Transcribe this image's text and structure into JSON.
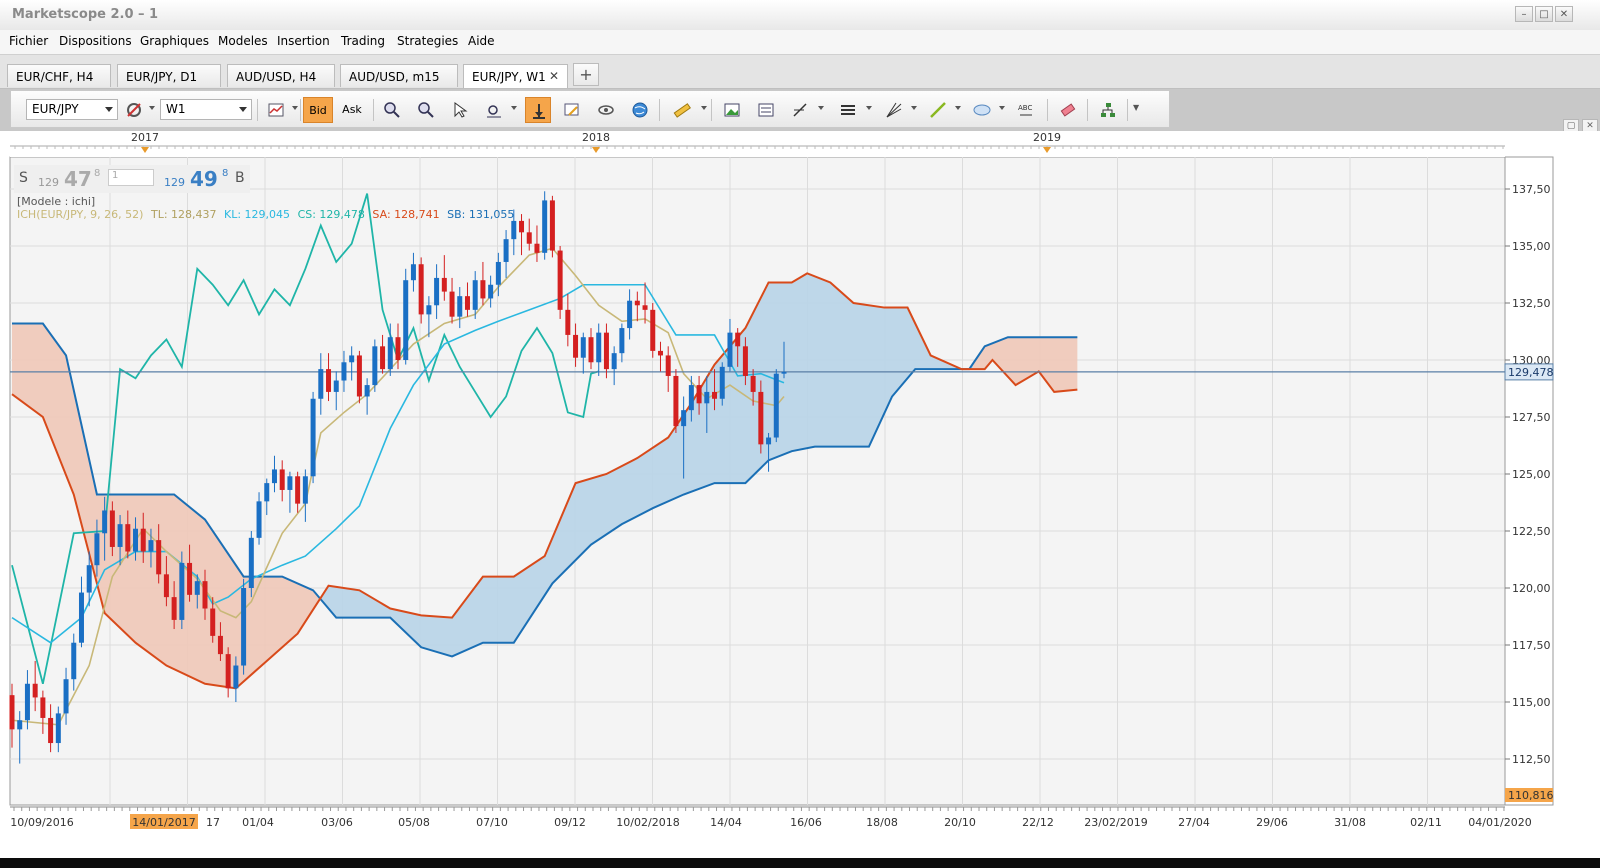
{
  "window": {
    "title": "Marketscope 2.0 – 1",
    "buttons": [
      "–",
      "□",
      "✕"
    ]
  },
  "menu": [
    "Fichier",
    "Dispositions",
    "Graphiques",
    "Modeles",
    "Insertion",
    "Trading",
    "Strategies",
    "Aide"
  ],
  "tabs": [
    {
      "label": "EUR/CHF, H4",
      "active": false
    },
    {
      "label": "EUR/JPY, D1",
      "active": false
    },
    {
      "label": "AUD/USD, H4",
      "active": false
    },
    {
      "label": "AUD/USD, m15",
      "active": false
    },
    {
      "label": "EUR/JPY, W1",
      "active": true,
      "close": "✕"
    }
  ],
  "tab_add": "+",
  "toolbar": {
    "symbol": "EUR/JPY",
    "timeframe": "W1",
    "bid_label": "Bid",
    "ask_label": "Ask",
    "accent": "#f5a54a"
  },
  "quote": {
    "sell_label": "S",
    "sell_big": "129",
    "sell_pips": "47",
    "sell_frac": "8",
    "amount": "1",
    "buy_big": "129",
    "buy_pips": "49",
    "buy_frac": "8",
    "buy_label": "B"
  },
  "legend": {
    "model": "[Modele : ichi]",
    "ich": "ICH(EUR/JPY, 9, 26, 52)",
    "tl": "TL: 128,437",
    "kl": "KL: 129,045",
    "cs": "CS: 129,478",
    "sa": "SA: 128,741",
    "sb": "SB: 131,055"
  },
  "chart_data": {
    "type": "candlestick",
    "symbol": "EUR/JPY",
    "timeframe": "W1",
    "title": "",
    "ylim": [
      110.816,
      138.5
    ],
    "y_ticks": [
      "137,50",
      "135,00",
      "132,50",
      "130,00",
      "127,50",
      "125,00",
      "122,50",
      "120,00",
      "117,50",
      "115,00",
      "112,50"
    ],
    "year_labels": [
      "2017",
      "2018",
      "2019"
    ],
    "x_ticks": [
      "10/09/2016",
      "14/01/2017",
      "17",
      "01/04",
      "03/06",
      "05/08",
      "07/10",
      "09/12",
      "10/02/2018",
      "14/04",
      "16/06",
      "18/08",
      "20/10",
      "22/12",
      "23/02/2019",
      "27/04",
      "29/06",
      "31/08",
      "02/11",
      "04/01/2020"
    ],
    "current_price": "129,478",
    "min_label": "110,816",
    "grid": true,
    "colors": {
      "up": "#1a6fc4",
      "down": "#d42020",
      "tenkan": "#c8b878",
      "kijun": "#2ab8e0",
      "chikou": "#1fb5a8",
      "span_a": "#d84a1a",
      "span_b": "#1a6fb5",
      "cloud_bull": "#b8d4e8",
      "cloud_bear": "#f0c8b8",
      "price_line": "#5a7fa6"
    },
    "candles": [
      [
        115.3,
        115.8,
        113.0,
        113.8
      ],
      [
        113.8,
        114.6,
        112.3,
        114.2
      ],
      [
        114.2,
        116.4,
        113.8,
        115.8
      ],
      [
        115.8,
        116.8,
        114.6,
        115.2
      ],
      [
        115.2,
        115.5,
        113.6,
        114.3
      ],
      [
        114.3,
        114.9,
        112.8,
        113.2
      ],
      [
        113.2,
        114.8,
        112.8,
        114.5
      ],
      [
        114.5,
        116.5,
        114.0,
        116.0
      ],
      [
        116.0,
        118.0,
        115.5,
        117.6
      ],
      [
        117.6,
        120.5,
        117.4,
        119.8
      ],
      [
        119.8,
        121.6,
        119.2,
        121.0
      ],
      [
        121.0,
        123.0,
        120.5,
        122.4
      ],
      [
        122.4,
        124.0,
        121.2,
        123.4
      ],
      [
        123.4,
        123.8,
        121.4,
        121.8
      ],
      [
        121.8,
        123.2,
        121.0,
        122.8
      ],
      [
        122.8,
        123.4,
        121.3,
        121.6
      ],
      [
        121.6,
        123.1,
        121.2,
        122.6
      ],
      [
        122.6,
        123.3,
        121.1,
        121.6
      ],
      [
        121.6,
        122.6,
        120.9,
        122.1
      ],
      [
        122.1,
        122.8,
        120.2,
        120.6
      ],
      [
        120.6,
        121.4,
        119.2,
        119.6
      ],
      [
        119.6,
        120.3,
        118.2,
        118.6
      ],
      [
        118.6,
        121.6,
        118.2,
        121.1
      ],
      [
        121.1,
        121.9,
        119.4,
        119.7
      ],
      [
        119.7,
        120.6,
        119.1,
        120.3
      ],
      [
        120.3,
        120.8,
        118.6,
        119.1
      ],
      [
        119.1,
        119.6,
        117.6,
        117.9
      ],
      [
        117.9,
        118.5,
        116.8,
        117.1
      ],
      [
        117.1,
        117.4,
        115.2,
        115.6
      ],
      [
        115.6,
        117.0,
        115.0,
        116.6
      ],
      [
        116.6,
        120.4,
        116.2,
        120.0
      ],
      [
        120.0,
        122.5,
        119.6,
        122.2
      ],
      [
        122.2,
        124.2,
        121.9,
        123.8
      ],
      [
        123.8,
        124.8,
        123.2,
        124.6
      ],
      [
        124.6,
        125.8,
        124.2,
        125.2
      ],
      [
        125.2,
        125.6,
        123.8,
        124.3
      ],
      [
        124.3,
        125.1,
        123.3,
        124.9
      ],
      [
        124.9,
        125.1,
        123.3,
        123.7
      ],
      [
        123.7,
        125.2,
        122.9,
        124.9
      ],
      [
        124.9,
        128.6,
        124.6,
        128.3
      ],
      [
        128.3,
        130.3,
        127.6,
        129.6
      ],
      [
        129.6,
        130.3,
        128.2,
        128.6
      ],
      [
        128.6,
        129.5,
        127.8,
        129.1
      ],
      [
        129.1,
        130.4,
        128.6,
        129.9
      ],
      [
        129.9,
        130.6,
        129.1,
        130.2
      ],
      [
        130.2,
        130.4,
        128.1,
        128.4
      ],
      [
        128.4,
        129.2,
        127.6,
        128.9
      ],
      [
        128.9,
        130.9,
        128.6,
        130.6
      ],
      [
        130.6,
        131.1,
        129.4,
        129.6
      ],
      [
        129.6,
        131.6,
        129.3,
        131.0
      ],
      [
        131.0,
        131.6,
        129.6,
        130.0
      ],
      [
        130.0,
        134.0,
        129.8,
        133.5
      ],
      [
        133.5,
        134.7,
        133.0,
        134.2
      ],
      [
        134.2,
        134.5,
        131.6,
        132.0
      ],
      [
        132.0,
        132.8,
        131.0,
        132.4
      ],
      [
        132.4,
        134.2,
        131.8,
        133.6
      ],
      [
        133.6,
        134.6,
        132.6,
        133.0
      ],
      [
        133.0,
        133.6,
        131.6,
        131.9
      ],
      [
        131.9,
        133.2,
        131.4,
        132.8
      ],
      [
        132.8,
        133.4,
        131.9,
        132.2
      ],
      [
        132.2,
        133.9,
        131.8,
        133.5
      ],
      [
        133.5,
        134.3,
        132.4,
        132.7
      ],
      [
        132.7,
        133.7,
        132.3,
        133.3
      ],
      [
        133.3,
        134.7,
        132.8,
        134.3
      ],
      [
        134.3,
        135.7,
        133.6,
        135.3
      ],
      [
        135.3,
        136.6,
        134.6,
        136.1
      ],
      [
        136.1,
        136.4,
        134.6,
        135.6
      ],
      [
        135.6,
        136.2,
        134.8,
        135.1
      ],
      [
        135.1,
        135.9,
        134.3,
        134.7
      ],
      [
        134.7,
        137.4,
        134.4,
        137.0
      ],
      [
        137.0,
        137.2,
        134.5,
        134.8
      ],
      [
        134.8,
        135.0,
        131.8,
        132.2
      ],
      [
        132.2,
        132.9,
        130.6,
        131.1
      ],
      [
        131.1,
        131.6,
        129.7,
        130.1
      ],
      [
        130.1,
        131.2,
        129.4,
        131.0
      ],
      [
        131.0,
        131.4,
        129.6,
        129.9
      ],
      [
        129.9,
        131.6,
        129.3,
        131.2
      ],
      [
        131.2,
        131.6,
        129.2,
        129.6
      ],
      [
        129.6,
        130.6,
        128.9,
        130.3
      ],
      [
        130.3,
        131.6,
        129.9,
        131.4
      ],
      [
        131.4,
        133.1,
        130.9,
        132.6
      ],
      [
        132.6,
        133.0,
        131.7,
        132.4
      ],
      [
        132.4,
        133.4,
        131.6,
        132.2
      ],
      [
        132.2,
        132.5,
        130.1,
        130.4
      ],
      [
        130.4,
        130.8,
        129.5,
        130.2
      ],
      [
        130.2,
        130.6,
        128.6,
        129.3
      ],
      [
        129.3,
        129.6,
        126.8,
        127.1
      ],
      [
        127.1,
        128.4,
        124.8,
        127.8
      ],
      [
        127.8,
        129.3,
        127.3,
        128.9
      ],
      [
        128.9,
        129.3,
        127.6,
        128.1
      ],
      [
        128.1,
        129.3,
        126.8,
        128.6
      ],
      [
        128.6,
        129.6,
        127.8,
        128.3
      ],
      [
        128.3,
        129.9,
        128.0,
        129.7
      ],
      [
        129.7,
        131.8,
        129.5,
        131.2
      ],
      [
        131.2,
        131.4,
        129.7,
        130.6
      ],
      [
        130.6,
        131.0,
        128.9,
        129.3
      ],
      [
        129.3,
        129.6,
        128.0,
        128.6
      ],
      [
        128.6,
        129.1,
        125.9,
        126.3
      ],
      [
        126.3,
        126.8,
        125.1,
        126.6
      ],
      [
        126.6,
        129.6,
        126.4,
        129.4
      ],
      [
        129.4,
        130.8,
        129.2,
        129.478
      ]
    ],
    "tenkan": [
      [
        0,
        114.2
      ],
      [
        6,
        114.0
      ],
      [
        10,
        116.6
      ],
      [
        13,
        120.5
      ],
      [
        17,
        122.6
      ],
      [
        20,
        121.6
      ],
      [
        24,
        120.4
      ],
      [
        27,
        119.0
      ],
      [
        29,
        118.7
      ],
      [
        31,
        119.4
      ],
      [
        35,
        122.4
      ],
      [
        38,
        123.7
      ],
      [
        40,
        126.8
      ],
      [
        43,
        127.7
      ],
      [
        46,
        128.5
      ],
      [
        49,
        129.6
      ],
      [
        52,
        130.7
      ],
      [
        56,
        131.6
      ],
      [
        60,
        132.0
      ],
      [
        63,
        133.2
      ],
      [
        67,
        134.6
      ],
      [
        70,
        134.9
      ],
      [
        73,
        133.7
      ],
      [
        76,
        132.4
      ],
      [
        79,
        131.7
      ],
      [
        82,
        131.8
      ],
      [
        85,
        131.2
      ],
      [
        87,
        129.4
      ],
      [
        90,
        128.3
      ],
      [
        93,
        128.9
      ],
      [
        96,
        128.2
      ],
      [
        99,
        128.0
      ],
      [
        100,
        128.4
      ]
    ],
    "kijun": [
      [
        0,
        118.7
      ],
      [
        5,
        117.6
      ],
      [
        9,
        118.7
      ],
      [
        12,
        120.8
      ],
      [
        16,
        121.6
      ],
      [
        20,
        121.6
      ],
      [
        24,
        120.5
      ],
      [
        26,
        119.3
      ],
      [
        28,
        119.6
      ],
      [
        31,
        120.4
      ],
      [
        35,
        121.0
      ],
      [
        38,
        121.4
      ],
      [
        42,
        122.6
      ],
      [
        45,
        123.6
      ],
      [
        49,
        127.0
      ],
      [
        52,
        128.9
      ],
      [
        56,
        130.7
      ],
      [
        60,
        131.3
      ],
      [
        63,
        131.7
      ],
      [
        67,
        132.2
      ],
      [
        71,
        132.7
      ],
      [
        74,
        133.3
      ],
      [
        78,
        133.3
      ],
      [
        82,
        133.3
      ],
      [
        86,
        131.1
      ],
      [
        91,
        131.1
      ],
      [
        94,
        129.3
      ],
      [
        97,
        129.4
      ],
      [
        100,
        129.0
      ]
    ],
    "chikou": [
      [
        0,
        121.0
      ],
      [
        4,
        115.8
      ],
      [
        8,
        122.4
      ],
      [
        12,
        122.5
      ],
      [
        14,
        129.6
      ],
      [
        16,
        129.2
      ],
      [
        18,
        130.2
      ],
      [
        20,
        130.9
      ],
      [
        22,
        129.7
      ],
      [
        24,
        134.0
      ],
      [
        26,
        133.3
      ],
      [
        28,
        132.4
      ],
      [
        30,
        133.5
      ],
      [
        32,
        132.0
      ],
      [
        34,
        133.1
      ],
      [
        36,
        132.4
      ],
      [
        38,
        134.0
      ],
      [
        40,
        135.9
      ],
      [
        42,
        134.3
      ],
      [
        44,
        135.1
      ],
      [
        46,
        137.3
      ],
      [
        48,
        132.2
      ],
      [
        50,
        130.0
      ],
      [
        52,
        131.4
      ],
      [
        54,
        129.1
      ],
      [
        56,
        131.1
      ],
      [
        58,
        129.7
      ],
      [
        60,
        128.6
      ],
      [
        62,
        127.5
      ],
      [
        64,
        128.4
      ],
      [
        66,
        130.4
      ],
      [
        68,
        131.4
      ],
      [
        70,
        130.3
      ],
      [
        72,
        127.7
      ],
      [
        74,
        127.5
      ],
      [
        75,
        129.4
      ],
      [
        76,
        129.5
      ]
    ],
    "span_a": [
      [
        0,
        128.5
      ],
      [
        4,
        127.5
      ],
      [
        8,
        124.1
      ],
      [
        12,
        118.9
      ],
      [
        16,
        117.6
      ],
      [
        20,
        116.6
      ],
      [
        25,
        115.8
      ],
      [
        29,
        115.6
      ],
      [
        33,
        116.8
      ],
      [
        37,
        118.0
      ],
      [
        41,
        120.1
      ],
      [
        45,
        119.9
      ],
      [
        49,
        119.1
      ],
      [
        53,
        118.8
      ],
      [
        57,
        118.7
      ],
      [
        61,
        120.5
      ],
      [
        65,
        120.5
      ],
      [
        69,
        121.4
      ],
      [
        73,
        124.6
      ],
      [
        77,
        125.0
      ],
      [
        81,
        125.7
      ],
      [
        85,
        126.6
      ],
      [
        88,
        128.1
      ],
      [
        91,
        129.8
      ],
      [
        95,
        131.4
      ],
      [
        98,
        133.4
      ],
      [
        101,
        133.4
      ],
      [
        103,
        133.8
      ],
      [
        106,
        133.4
      ],
      [
        109,
        132.5
      ],
      [
        113,
        132.3
      ],
      [
        116,
        132.3
      ],
      [
        119,
        130.2
      ],
      [
        123,
        129.6
      ],
      [
        126,
        129.6
      ],
      [
        127,
        130.0
      ],
      [
        130,
        128.9
      ],
      [
        133,
        129.5
      ],
      [
        135,
        128.6
      ],
      [
        138,
        128.7
      ]
    ],
    "span_b": [
      [
        0,
        131.6
      ],
      [
        4,
        131.6
      ],
      [
        7,
        130.2
      ],
      [
        11,
        124.1
      ],
      [
        14,
        124.1
      ],
      [
        18,
        124.1
      ],
      [
        21,
        124.1
      ],
      [
        25,
        123.0
      ],
      [
        30,
        120.5
      ],
      [
        35,
        120.5
      ],
      [
        39,
        119.9
      ],
      [
        42,
        118.7
      ],
      [
        45,
        118.7
      ],
      [
        49,
        118.7
      ],
      [
        53,
        117.4
      ],
      [
        57,
        117.0
      ],
      [
        61,
        117.6
      ],
      [
        65,
        117.6
      ],
      [
        70,
        120.2
      ],
      [
        75,
        121.9
      ],
      [
        79,
        122.8
      ],
      [
        83,
        123.5
      ],
      [
        87,
        124.1
      ],
      [
        91,
        124.6
      ],
      [
        95,
        124.6
      ],
      [
        98,
        125.6
      ],
      [
        101,
        126.0
      ],
      [
        104,
        126.2
      ],
      [
        108,
        126.2
      ],
      [
        111,
        126.2
      ],
      [
        114,
        128.4
      ],
      [
        117,
        129.6
      ],
      [
        120,
        129.6
      ],
      [
        124,
        129.6
      ],
      [
        126,
        130.6
      ],
      [
        129,
        131.0
      ],
      [
        133,
        131.0
      ],
      [
        138,
        131.0
      ]
    ]
  }
}
